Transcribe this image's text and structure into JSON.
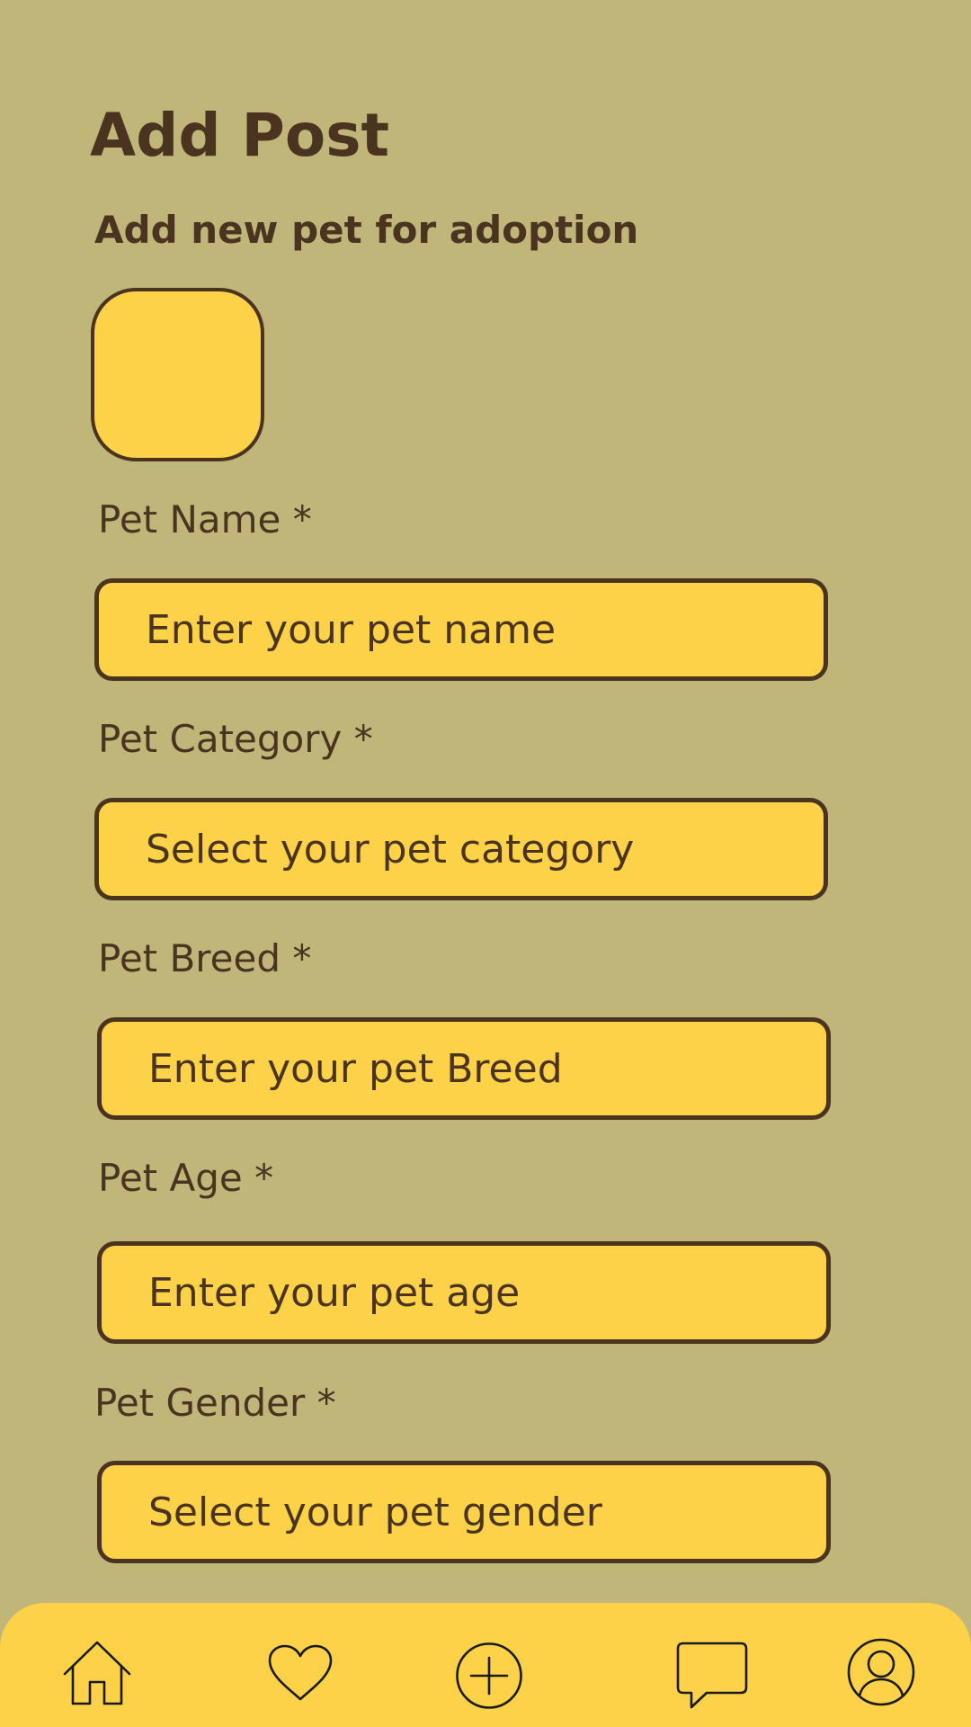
{
  "header": {
    "title": "Add Post",
    "subtitle": "Add new pet for adoption"
  },
  "form": {
    "fields": [
      {
        "label": "Pet Name *",
        "placeholder": "Enter your pet name",
        "type": "text"
      },
      {
        "label": "Pet Category *",
        "placeholder": "Select your pet category",
        "type": "select"
      },
      {
        "label": "Pet Breed *",
        "placeholder": "Enter your pet Breed",
        "type": "text"
      },
      {
        "label": "Pet Age *",
        "placeholder": "Enter your pet age",
        "type": "text"
      },
      {
        "label": "Pet Gender *",
        "placeholder": "Select your pet gender",
        "type": "select"
      }
    ]
  },
  "bottom_nav": {
    "items": [
      {
        "name": "home",
        "icon": "home-icon"
      },
      {
        "name": "favorites",
        "icon": "heart-icon"
      },
      {
        "name": "add-post",
        "icon": "plus-circle-icon"
      },
      {
        "name": "messages",
        "icon": "chat-bubble-icon"
      },
      {
        "name": "profile",
        "icon": "user-circle-icon"
      }
    ]
  },
  "colors": {
    "background": "#C1B67A",
    "accent": "#FDD248",
    "text": "#4A3420",
    "border": "#4A3420",
    "nav_icon": "#1A1A1A"
  }
}
